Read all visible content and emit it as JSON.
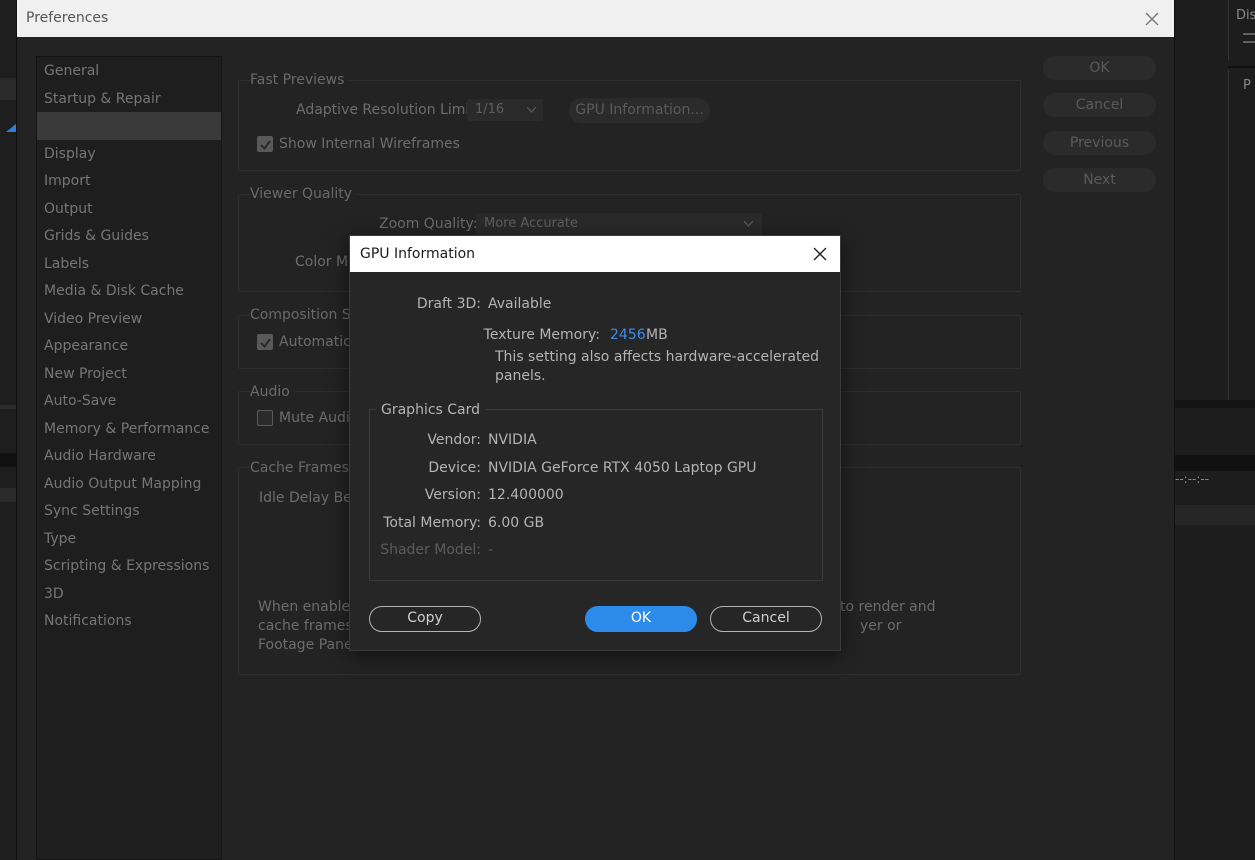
{
  "prefs": {
    "title": "Preferences",
    "categories": [
      "General",
      "Startup & Repair",
      "",
      "Display",
      "Import",
      "Output",
      "Grids & Guides",
      "Labels",
      "Media & Disk Cache",
      "Video Preview",
      "Appearance",
      "New Project",
      "Auto-Save",
      "Memory & Performance",
      "Audio Hardware",
      "Audio Output Mapping",
      "Sync Settings",
      "Type",
      "Scripting & Expressions",
      "3D",
      "Notifications"
    ],
    "selected_index": 2,
    "buttons": {
      "ok": "OK",
      "cancel": "Cancel",
      "previous": "Previous",
      "next": "Next"
    },
    "fast_previews": {
      "label": "Fast Previews",
      "adaptive_label": "Adaptive Resolution Limit:",
      "adaptive_value": "1/16",
      "gpu_info_button": "GPU Information...",
      "wireframes_label": "Show Internal Wireframes"
    },
    "viewer_quality": {
      "label": "Viewer Quality",
      "zoom_label": "Zoom Quality:",
      "zoom_value": "More Accurate",
      "color_label": "Color Ma"
    },
    "composition": {
      "label": "Composition Sw",
      "auto_label": "Automatica"
    },
    "audio": {
      "label": "Audio",
      "mute_label": "Mute Audio"
    },
    "cache": {
      "label": "Cache Frames W",
      "idle_label": "Idle Delay Befo",
      "desc_line1": "When enabled",
      "desc_line2": "cache frames in",
      "desc_line3": "Footage Panel",
      "desc_right1": "to render and",
      "desc_right2": "yer or"
    },
    "bg_timecode": "--:--:--",
    "bg_tab1": "Dis",
    "bg_tab2": "P"
  },
  "gpu": {
    "title": "GPU Information",
    "draft3d_label": "Draft 3D:",
    "draft3d_value": "Available",
    "texture_label": "Texture Memory:",
    "texture_value": "2456",
    "texture_unit": "MB",
    "note_line1": "This setting also affects hardware-accelerated",
    "note_line2": "panels.",
    "card_group_label": "Graphics Card",
    "vendor_label": "Vendor:",
    "vendor_value": "NVIDIA",
    "device_label": "Device:",
    "device_value": "NVIDIA GeForce RTX 4050 Laptop GPU",
    "version_label": "Version:",
    "version_value": "12.400000",
    "total_memory_label": "Total Memory:",
    "total_memory_value": "6.00 GB",
    "shader_label": "Shader Model:",
    "shader_value": "-",
    "copy_button": "Copy",
    "ok_button": "OK",
    "cancel_button": "Cancel"
  },
  "colors": {
    "accent": "#2d8ceb",
    "texture_value": "#3c8ce8"
  }
}
